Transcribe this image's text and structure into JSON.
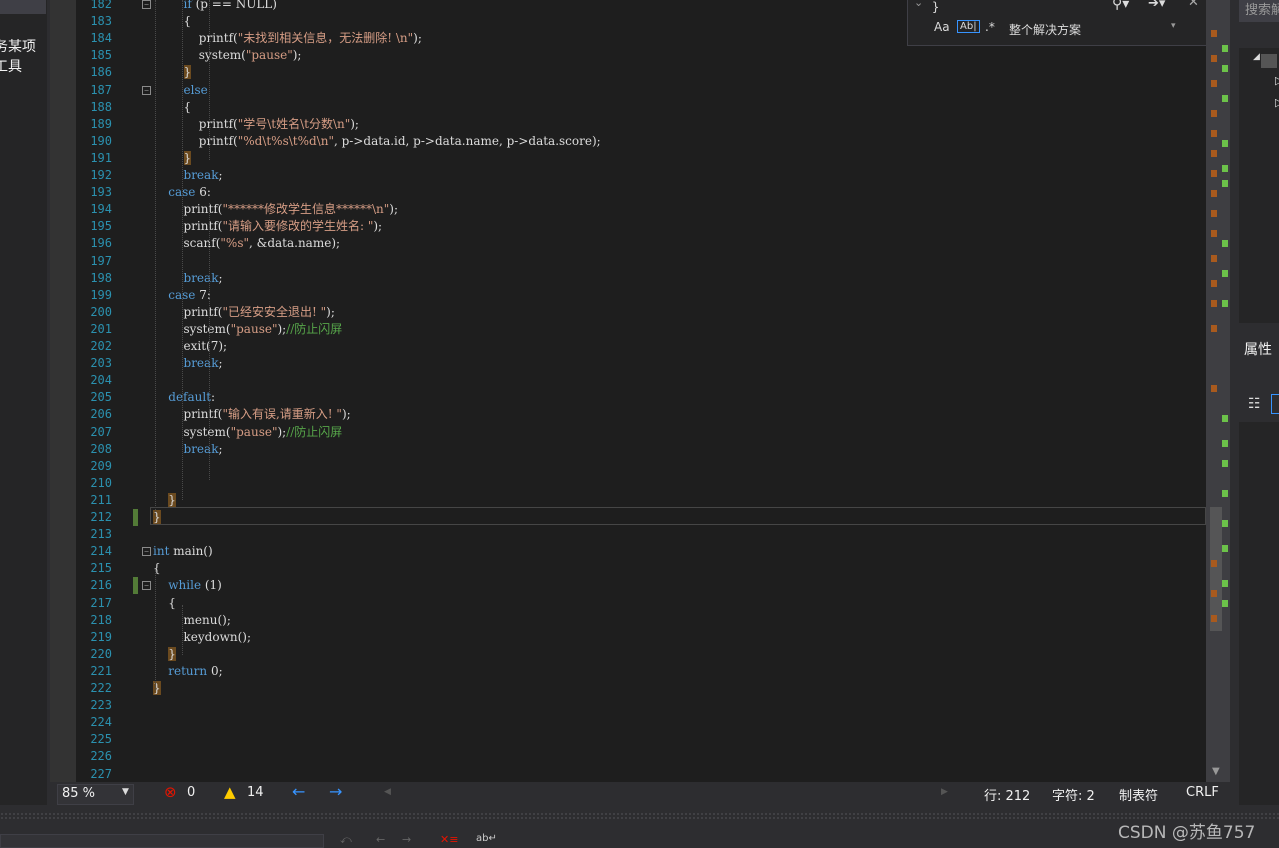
{
  "left_panel": {
    "line1": "务某项",
    "line2": "工具"
  },
  "find_widget": {
    "search_value": "}",
    "match_case_label": "Aa",
    "whole_word_label": "Ab|",
    "regex_label": ".*",
    "scope": "整个解决方案"
  },
  "right_panel": {
    "search_header": "搜索解",
    "properties_title": "属性"
  },
  "editor": {
    "lines": [
      {
        "n": "182",
        "html": "        <span class='kw'>if</span> (p == NULL)"
      },
      {
        "n": "183",
        "html": "        {"
      },
      {
        "n": "184",
        "html": "            printf(<span class='str'>\"未找到相关信息，无法删除! \\n\"</span>);"
      },
      {
        "n": "185",
        "html": "            system(<span class='str'>\"pause\"</span>);"
      },
      {
        "n": "186",
        "html": "        <span class='hl-brace'>}</span>"
      },
      {
        "n": "187",
        "html": "        <span class='kw'>else</span>"
      },
      {
        "n": "188",
        "html": "        {"
      },
      {
        "n": "189",
        "html": "            printf(<span class='str'>\"学号\\t姓名\\t分数\\n\"</span>);"
      },
      {
        "n": "190",
        "html": "            printf(<span class='str'>\"%d\\t%s\\t%d\\n\"</span>, p->data.id, p->data.name, p->data.score);"
      },
      {
        "n": "191",
        "html": "        <span class='hl-brace'>}</span>"
      },
      {
        "n": "192",
        "html": "        <span class='kw'>break</span>;"
      },
      {
        "n": "193",
        "html": "    <span class='kw'>case</span> 6:"
      },
      {
        "n": "194",
        "html": "        printf(<span class='str'>\"******修改学生信息******\\n\"</span>);"
      },
      {
        "n": "195",
        "html": "        printf(<span class='str'>\"请输入要修改的学生姓名: \"</span>);"
      },
      {
        "n": "196",
        "html": "        scanf(<span class='str'>\"%s\"</span>, &data.name);"
      },
      {
        "n": "197",
        "html": ""
      },
      {
        "n": "198",
        "html": "        <span class='kw'>break</span>;"
      },
      {
        "n": "199",
        "html": "    <span class='kw'>case</span> 7:"
      },
      {
        "n": "200",
        "html": "        printf(<span class='str'>\"已经安安全退出! \"</span>);"
      },
      {
        "n": "201",
        "html": "        system(<span class='str'>\"pause\"</span>);<span class='com'>//防止闪屏</span>"
      },
      {
        "n": "202",
        "html": "        exit(7);"
      },
      {
        "n": "203",
        "html": "        <span class='kw'>break</span>;"
      },
      {
        "n": "204",
        "html": ""
      },
      {
        "n": "205",
        "html": "    <span class='kw'>default</span>:"
      },
      {
        "n": "206",
        "html": "        printf(<span class='str'>\"输入有误,请重新入! \"</span>);"
      },
      {
        "n": "207",
        "html": "        system(<span class='str'>\"pause\"</span>);<span class='com'>//防止闪屏</span>"
      },
      {
        "n": "208",
        "html": "        <span class='kw'>break</span>;"
      },
      {
        "n": "209",
        "html": ""
      },
      {
        "n": "210",
        "html": ""
      },
      {
        "n": "211",
        "html": "    <span class='hl-brace'>}</span>"
      },
      {
        "n": "212",
        "html": "<span class='hl-brace'>}</span>"
      },
      {
        "n": "213",
        "html": ""
      },
      {
        "n": "214",
        "html": "<span class='kw'>int</span> main()"
      },
      {
        "n": "215",
        "html": "{"
      },
      {
        "n": "216",
        "html": "    <span class='kw'>while</span> (1)"
      },
      {
        "n": "217",
        "html": "    {"
      },
      {
        "n": "218",
        "html": "        menu();"
      },
      {
        "n": "219",
        "html": "        keydown();"
      },
      {
        "n": "220",
        "html": "    <span class='hl-brace'>}</span>"
      },
      {
        "n": "221",
        "html": "    <span class='kw'>return</span> 0;"
      },
      {
        "n": "222",
        "html": "<span class='hl-brace'>}</span>"
      },
      {
        "n": "223",
        "html": ""
      },
      {
        "n": "224",
        "html": ""
      },
      {
        "n": "225",
        "html": ""
      },
      {
        "n": "226",
        "html": ""
      },
      {
        "n": "227",
        "html": ""
      }
    ]
  },
  "status": {
    "zoom": "85 %",
    "errors": "0",
    "warnings": "14",
    "line": "行: 212",
    "char": "字符: 2",
    "indent": "制表符",
    "eol": "CRLF"
  },
  "watermark": "CSDN @苏鱼757"
}
